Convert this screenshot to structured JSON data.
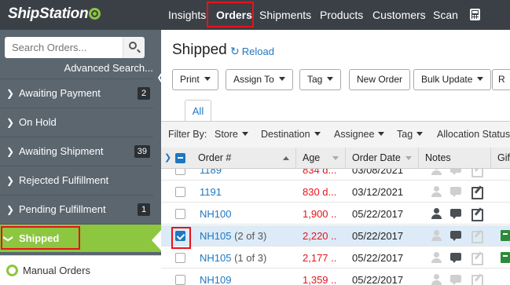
{
  "app": {
    "logo_text": "ShipStation",
    "brand_color": "#8dc63f",
    "accent_color": "#1f77c0",
    "highlight_color": "#e8121b"
  },
  "nav": {
    "items": [
      {
        "label": "Insights",
        "active": false
      },
      {
        "label": "Orders",
        "active": true
      },
      {
        "label": "Shipments",
        "active": false
      },
      {
        "label": "Products",
        "active": false
      },
      {
        "label": "Customers",
        "active": false
      },
      {
        "label": "Scan",
        "active": false
      }
    ],
    "calculator_icon": "calculator-icon"
  },
  "sidebar": {
    "search_placeholder": "Search Orders...",
    "search_icon": "search-icon",
    "advanced_search_label": "Advanced Search...",
    "items": [
      {
        "label": "Awaiting Payment",
        "count": "2"
      },
      {
        "label": "On Hold",
        "count": ""
      },
      {
        "label": "Awaiting Shipment",
        "count": "39"
      },
      {
        "label": "Rejected Fulfillment",
        "count": ""
      },
      {
        "label": "Pending Fulfillment",
        "count": "1"
      },
      {
        "label": "Shipped",
        "count": "",
        "active": true
      }
    ],
    "manual_orders_label": "Manual Orders"
  },
  "main": {
    "title": "Shipped",
    "reload_label": "Reload",
    "toolbar": {
      "print": "Print",
      "assign_to": "Assign To",
      "tag": "Tag",
      "new_order": "New Order",
      "bulk_update": "Bulk Update",
      "cut": "R"
    },
    "tab_all": "All",
    "filter": {
      "label": "Filter By:",
      "store": "Store",
      "destination": "Destination",
      "assignee": "Assignee",
      "tag": "Tag",
      "allocation": "Allocation Status"
    },
    "columns": {
      "order": "Order #",
      "age": "Age",
      "order_date": "Order Date",
      "notes": "Notes",
      "gift": "Gif"
    },
    "rows": [
      {
        "order": "1189",
        "sub": "",
        "age": "834 d...",
        "date": "03/08/2021",
        "selected": false,
        "notes_active": false,
        "gift": false
      },
      {
        "order": "1191",
        "sub": "",
        "age": "830 d...",
        "date": "03/12/2021",
        "selected": false,
        "notes_active": false,
        "gift": false
      },
      {
        "order": "NH100",
        "sub": "",
        "age": "1,900 ...",
        "date": "05/22/2017",
        "selected": false,
        "notes_active": true,
        "gift": false
      },
      {
        "order": "NH105",
        "sub": "(2 of 3)",
        "age": "2,220 ...",
        "date": "05/22/2017",
        "selected": true,
        "notes_active": true,
        "gift": true
      },
      {
        "order": "NH105",
        "sub": "(1 of 3)",
        "age": "2,177 ...",
        "date": "05/22/2017",
        "selected": false,
        "notes_active": true,
        "gift": true
      },
      {
        "order": "NH109",
        "sub": "",
        "age": "1,359 ...",
        "date": "05/22/2017",
        "selected": false,
        "notes_active": false,
        "gift": false
      }
    ]
  }
}
